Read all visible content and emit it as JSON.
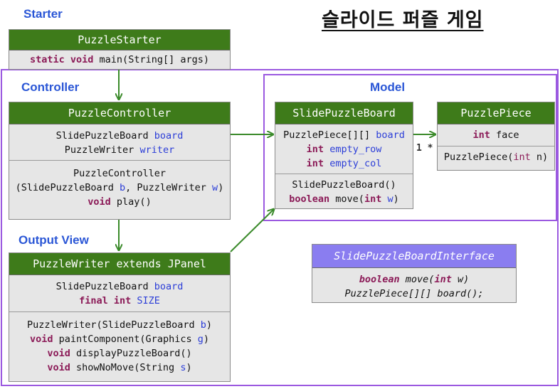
{
  "title": "슬라이드 퍼즐 게임",
  "sections": {
    "starter": "Starter",
    "controller": "Controller",
    "model": "Model",
    "output_view": "Output View"
  },
  "multiplicity": "1 *",
  "classes": {
    "puzzle_starter": {
      "name": "PuzzleStarter",
      "method": {
        "kw": "static void",
        "rest": " main(String[] args)"
      }
    },
    "puzzle_controller": {
      "name": "PuzzleController",
      "field1": {
        "type": "SlidePuzzleBoard ",
        "var": "board"
      },
      "field2": {
        "type": "PuzzleWriter ",
        "var": "writer"
      },
      "ctor_line1": "PuzzleController",
      "ctor_line2": {
        "a": "(SlidePuzzleBoard ",
        "b": "b",
        "c": ", PuzzleWriter ",
        "d": "w",
        "e": ")"
      },
      "play": {
        "kw": "void",
        "rest": " play()"
      }
    },
    "slide_puzzle_board": {
      "name": "SlidePuzzleBoard",
      "field1": {
        "type": "PuzzlePiece[][] ",
        "var": "board"
      },
      "field2": {
        "kw": "int",
        "var": "empty_row"
      },
      "field3": {
        "kw": "int",
        "var": "empty_col"
      },
      "ctor": "SlidePuzzleBoard()",
      "move": {
        "kw": "boolean",
        "rest1": " move(",
        "kw2": "int",
        "var": " w",
        "rest2": ")"
      }
    },
    "puzzle_piece": {
      "name": "PuzzlePiece",
      "field": {
        "kw": "int",
        "rest": " face"
      },
      "ctor": {
        "a": "PuzzlePiece(",
        "kw": "int",
        "b": " n)"
      }
    },
    "puzzle_writer": {
      "name": "PuzzleWriter extends JPanel",
      "field1": {
        "type": "SlidePuzzleBoard ",
        "var": "board"
      },
      "field2": {
        "kw": "final int",
        "var": "SIZE"
      },
      "m1": {
        "a": "PuzzleWriter(SlidePuzzleBoard ",
        "var": "b",
        "b": ")"
      },
      "m2": {
        "kw": "void",
        "a": " paintComponent(Graphics ",
        "var": "g",
        "b": ")"
      },
      "m3": {
        "kw": "void",
        "a": " displayPuzzleBoard()"
      },
      "m4": {
        "kw": "void",
        "a": " showNoMove(String ",
        "var": "s",
        "b": ")"
      }
    },
    "slide_puzzle_board_interface": {
      "name": "SlidePuzzleBoardInterface",
      "move": {
        "kw": "boolean",
        "a": " move(",
        "kw2": "int",
        "var": " w",
        "b": ")"
      },
      "board": "PuzzlePiece[][] board();"
    }
  },
  "colors": {
    "header_green": "#3e7b1a",
    "interface_purple": "#8a7df0",
    "frame_purple": "#9b59e0",
    "arrow_green": "#3a8a2a",
    "section_blue": "#2a56d6"
  }
}
